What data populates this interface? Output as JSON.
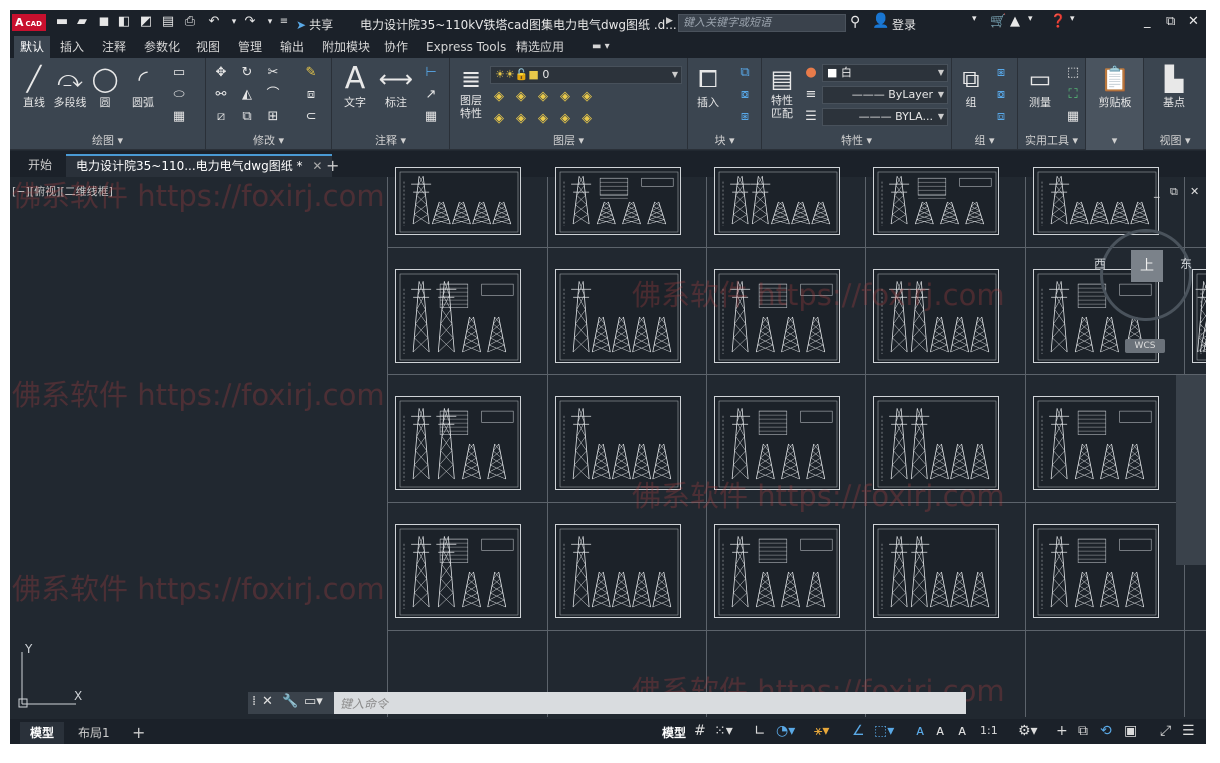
{
  "app": {
    "logo": "A",
    "logo_sub": "CAD",
    "share": "共享",
    "doc_title": "电力设计院35~110kV铁塔cad图集电力电气dwg图纸 .d...",
    "search_placeholder": "键入关键字或短语",
    "login": "登录"
  },
  "menu_tabs": [
    "默认",
    "插入",
    "注释",
    "参数化",
    "视图",
    "管理",
    "输出",
    "附加模块",
    "协作",
    "Express Tools",
    "精选应用"
  ],
  "ribbon": {
    "draw": {
      "title": "绘图 ▾",
      "line": "直线",
      "polyline": "多段线",
      "circle": "圆",
      "arc": "圆弧"
    },
    "modify": {
      "title": "修改 ▾"
    },
    "annotation": {
      "title": "注释 ▾",
      "text": "文字",
      "dimension": "标注"
    },
    "layers": {
      "title": "图层 ▾",
      "layer_props": "图层\n特性",
      "current_layer": "0"
    },
    "block": {
      "title": "块 ▾",
      "insert": "插入"
    },
    "properties": {
      "title": "特性 ▾",
      "match": "特性\n匹配",
      "color": "白",
      "linetype": "ByLayer",
      "lineweight": "BYLA..."
    },
    "groups": {
      "title": "组 ▾",
      "group": "组"
    },
    "utilities": {
      "title": "实用工具 ▾",
      "measure": "测量"
    },
    "clipboard": {
      "title": "▾",
      "paste": "剪贴板"
    },
    "view": {
      "title": "视图 ▾",
      "base": "基点"
    }
  },
  "doc_tabs": {
    "start": "开始",
    "active": "电力设计院35~110...电力电气dwg图纸 *"
  },
  "viewport_label": "[−][俯视][二维线框]",
  "viewcube": {
    "top": "上",
    "west": "西",
    "east": "东",
    "wcs": "WCS"
  },
  "ucs": {
    "y": "Y",
    "x": "X"
  },
  "command": {
    "placeholder": "键入命令"
  },
  "layout_tabs": {
    "model": "模型",
    "layout1": "布局1"
  },
  "status": {
    "model": "模型",
    "scale": "1:1"
  },
  "watermark": "佛系软件 https://foxirj.com",
  "sheets": {
    "row0": 5,
    "row1": 6,
    "row2": 6,
    "row3": 5
  },
  "colors": {
    "accent": "#5aa9e6",
    "logo": "#c8102e",
    "canvas": "#212830"
  }
}
